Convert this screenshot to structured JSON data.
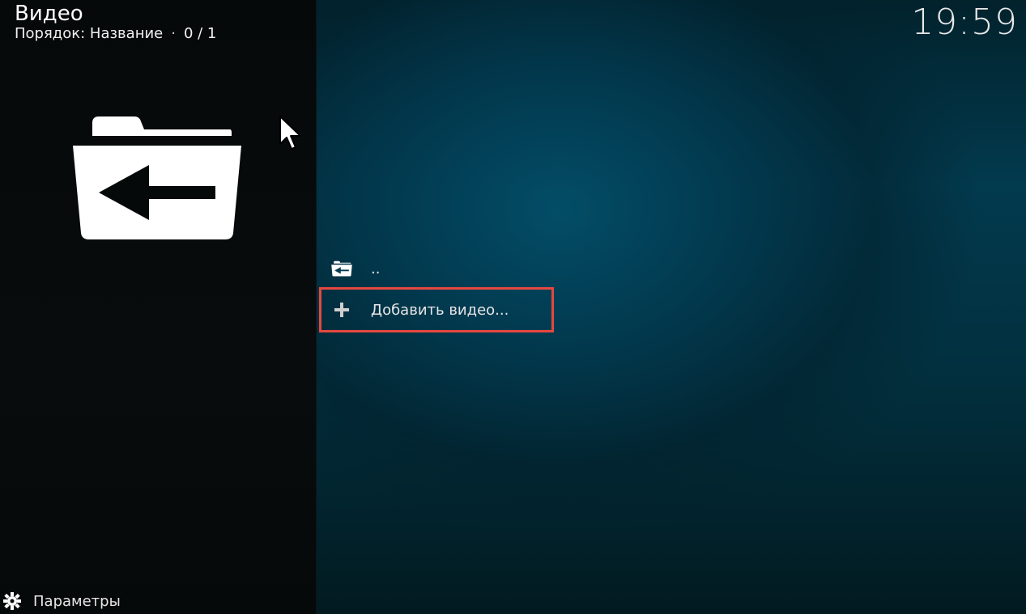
{
  "header": {
    "title": "Видео",
    "sort_label": "Порядок: Название",
    "separator": "·",
    "count": "0 / 1",
    "clock": "19:59"
  },
  "left_panel": {
    "big_icon": "folder-back-icon"
  },
  "list": {
    "items": [
      {
        "label": "..",
        "icon": "folder-back-icon"
      },
      {
        "label": "Добавить видео...",
        "icon": "plus-icon",
        "highlighted": true
      }
    ]
  },
  "footer": {
    "settings_label": "Параметры",
    "settings_icon": "gear-icon"
  },
  "colors": {
    "highlight_border": "#e5483f",
    "background_accent": "#034e68"
  }
}
